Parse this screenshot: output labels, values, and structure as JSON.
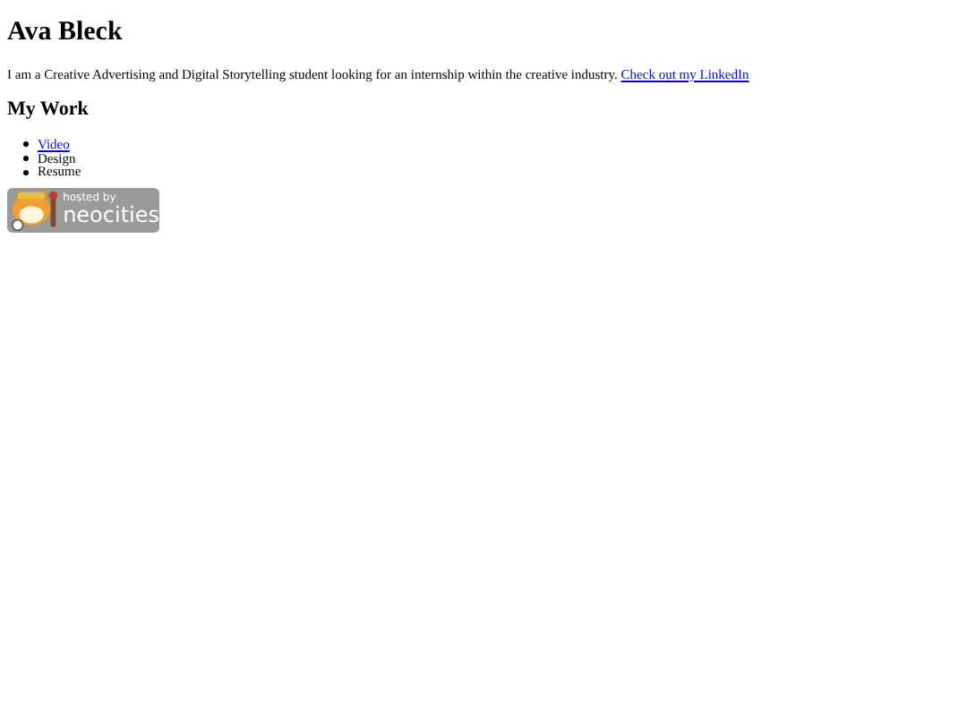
{
  "title": "Ava Bleck",
  "intro": {
    "text": "I am a Creative Advertising and Digital Storytelling student looking for an internship within the creative industry.",
    "link": "Check out my LinkedIn"
  },
  "section_heading": "My Work",
  "work_items": [
    {
      "label": "Video",
      "kind": "link"
    },
    {
      "label": "Design",
      "kind": "text"
    },
    {
      "label": "Resume",
      "kind": "text"
    }
  ],
  "badge": {
    "line_1": "hosted by",
    "line_2": "neocities"
  }
}
